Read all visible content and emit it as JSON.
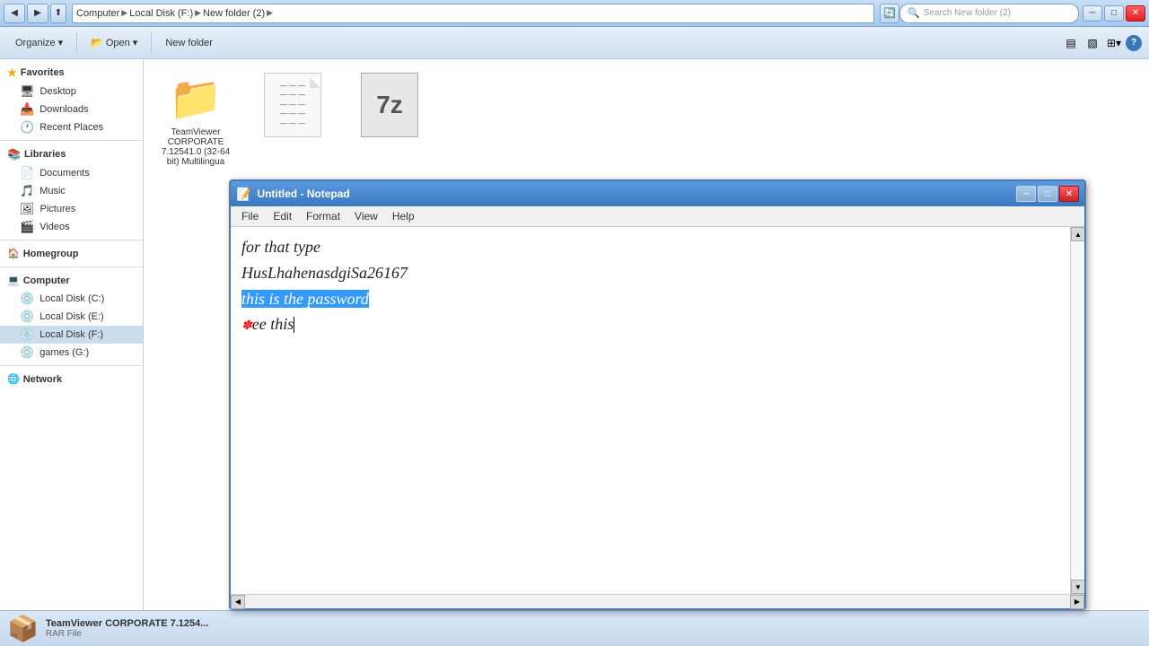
{
  "explorer": {
    "title": "New folder (2)",
    "address": {
      "computer": "Computer",
      "drive": "Local Disk (F:)",
      "folder": "New folder (2)"
    },
    "search_placeholder": "Search New folder (2)",
    "toolbar": {
      "organize": "Organize",
      "open": "Open",
      "new_folder": "New folder"
    },
    "sidebar": {
      "favorites_label": "Favorites",
      "favorites_items": [
        {
          "label": "Desktop",
          "icon": "🖥"
        },
        {
          "label": "Downloads",
          "icon": "📥"
        },
        {
          "label": "Recent Places",
          "icon": "🕐"
        }
      ],
      "libraries_label": "Libraries",
      "libraries_items": [
        {
          "label": "Documents",
          "icon": "📄"
        },
        {
          "label": "Music",
          "icon": "🎵"
        },
        {
          "label": "Pictures",
          "icon": "🖼"
        },
        {
          "label": "Videos",
          "icon": "🎬"
        }
      ],
      "homegroup_label": "Homegroup",
      "computer_label": "Computer",
      "computer_items": [
        {
          "label": "Local Disk (C:)",
          "icon": "💿"
        },
        {
          "label": "Local Disk (E:)",
          "icon": "💿"
        },
        {
          "label": "Local Disk (F:)",
          "icon": "💿"
        },
        {
          "label": "games (G:)",
          "icon": "💿"
        }
      ],
      "network_label": "Network"
    },
    "files": [
      {
        "name": "TeamViewer CORPORATE 7.12541.0 (32-64 bit) Multilingua",
        "type": "folder"
      },
      {
        "name": "",
        "type": "doc"
      },
      {
        "name": "",
        "type": "7z"
      }
    ],
    "status": {
      "icon": "📦",
      "text": "TeamViewer CORPORATE 7.1254...",
      "subtext": "RAR File"
    }
  },
  "notepad": {
    "title": "Untitled - Notepad",
    "menu": [
      "File",
      "Edit",
      "Format",
      "View",
      "Help"
    ],
    "lines": [
      {
        "text": "for that type",
        "selected": false
      },
      {
        "text": "HusLhahenasdgiSa26167",
        "selected": false
      },
      {
        "text": "this is the password",
        "selected": true
      },
      {
        "text": "see this",
        "selected": false,
        "prefix_star": true
      }
    ]
  }
}
